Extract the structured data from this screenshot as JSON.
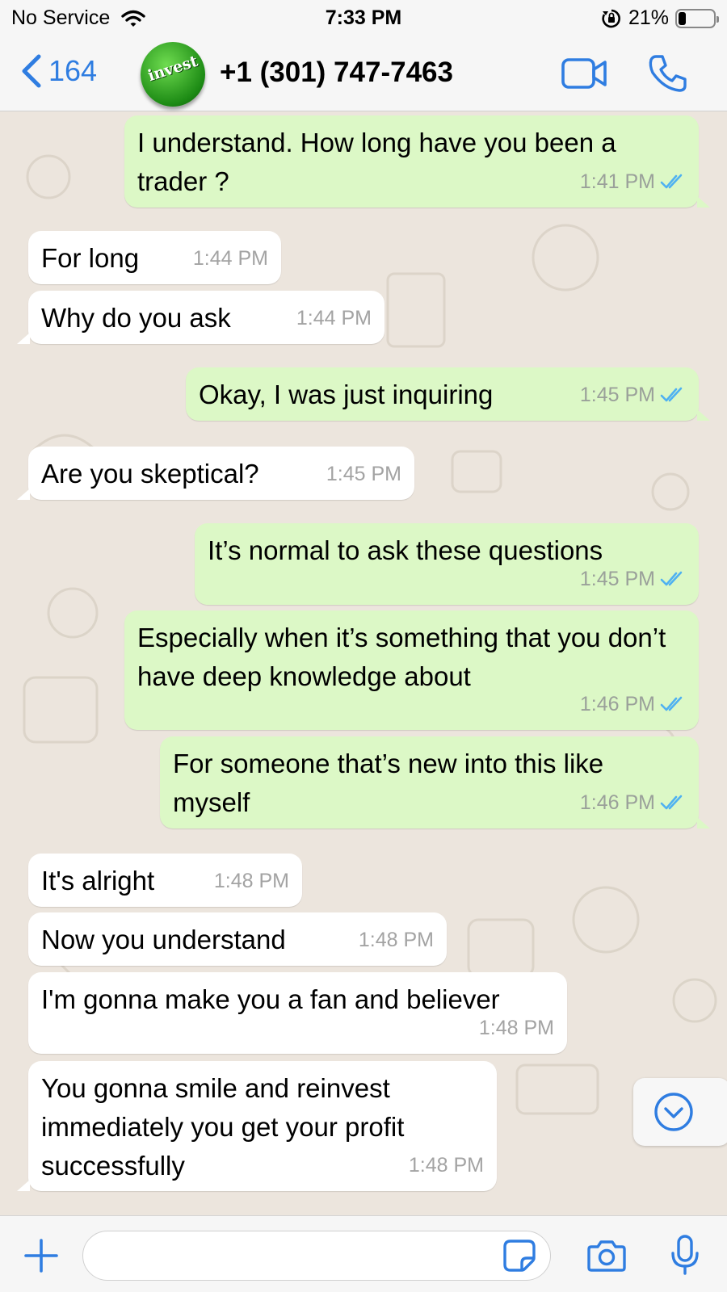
{
  "status_bar": {
    "carrier": "No Service",
    "time": "7:33 PM",
    "battery_percent_label": "21%",
    "battery_level": 0.21
  },
  "header": {
    "back_count": "164",
    "avatar_text": "invest",
    "contact_name": "+1 (301) 747-7463"
  },
  "colors": {
    "accent": "#2f7de1",
    "outgoing_bubble": "#dcf8c6",
    "incoming_bubble": "#ffffff",
    "read_ticks": "#4fb1f1"
  },
  "messages": [
    {
      "dir": "out",
      "text": "I understand. How long have you been a trader ?",
      "time": "1:41 PM",
      "status": "read"
    },
    {
      "dir": "in",
      "text": "For long",
      "time": "1:44 PM"
    },
    {
      "dir": "in",
      "text": "Why do you ask",
      "time": "1:44 PM"
    },
    {
      "dir": "out",
      "text": "Okay, I was just inquiring",
      "time": "1:45 PM",
      "status": "read"
    },
    {
      "dir": "in",
      "text": "Are you skeptical?",
      "time": "1:45 PM"
    },
    {
      "dir": "out",
      "text": "It’s normal to ask these questions",
      "time": "1:45 PM",
      "status": "read"
    },
    {
      "dir": "out",
      "text": "Especially when it’s something that you don’t have deep knowledge about",
      "time": "1:46 PM",
      "status": "read"
    },
    {
      "dir": "out",
      "text": "For someone that’s new into this like myself",
      "time": "1:46 PM",
      "status": "read"
    },
    {
      "dir": "in",
      "text": "It's alright",
      "time": "1:48 PM"
    },
    {
      "dir": "in",
      "text": "Now you understand",
      "time": "1:48 PM"
    },
    {
      "dir": "in",
      "text": "I'm gonna make you a fan and believer",
      "time": "1:48 PM"
    },
    {
      "dir": "in",
      "text": "You gonna smile and reinvest immediately you get your profit successfully",
      "time": "1:48 PM"
    }
  ],
  "input": {
    "placeholder": "",
    "value": ""
  },
  "icons": {
    "back": "chevron-left-icon",
    "video": "video-call-icon",
    "call": "phone-icon",
    "scroll": "chevron-down-circle-icon",
    "attach": "plus-icon",
    "sticker": "sticker-icon",
    "camera": "camera-icon",
    "mic": "microphone-icon"
  }
}
